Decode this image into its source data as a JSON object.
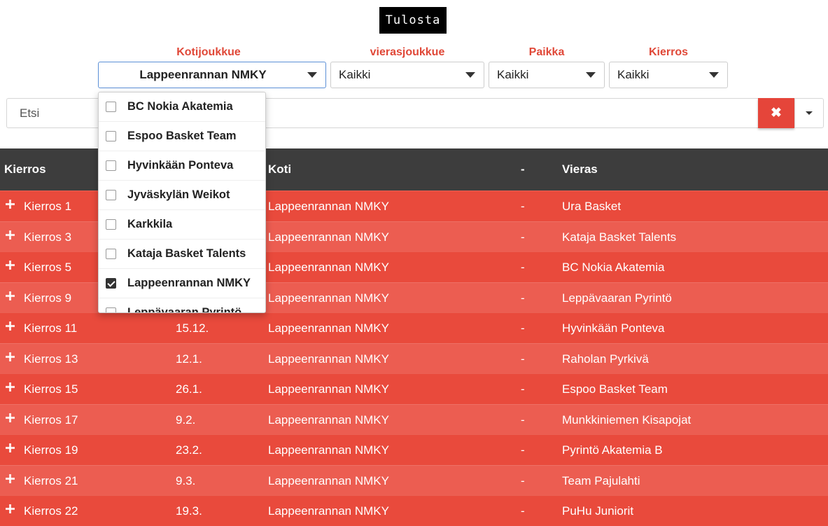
{
  "print_button": "Tulosta",
  "filters": {
    "home": {
      "label": "Kotijoukkue",
      "value": "Lappeenrannan NMKY"
    },
    "away": {
      "label": "vierasjoukkue",
      "value": "Kaikki"
    },
    "place": {
      "label": "Paikka",
      "value": "Kaikki"
    },
    "round": {
      "label": "Kierros",
      "value": "Kaikki"
    }
  },
  "search": {
    "placeholder": "Etsi",
    "clear_icon": "close-icon",
    "more_icon": "caret-down-icon"
  },
  "dropdown_options": [
    {
      "label": "BC Nokia Akatemia",
      "checked": false
    },
    {
      "label": "Espoo Basket Team",
      "checked": false
    },
    {
      "label": "Hyvinkään Ponteva",
      "checked": false
    },
    {
      "label": "Jyväskylän Weikot",
      "checked": false
    },
    {
      "label": "Karkkila",
      "checked": false
    },
    {
      "label": "Kataja Basket Talents",
      "checked": false
    },
    {
      "label": "Lappeenrannan NMKY",
      "checked": true
    },
    {
      "label": "Leppävaaran Pyrintö",
      "checked": false
    }
  ],
  "table": {
    "headers": {
      "round": "Kierros",
      "home": "Koti",
      "dash": "-",
      "away": "Vieras"
    },
    "rows": [
      {
        "round": "Kierros 1",
        "date": "",
        "home": "Lappeenrannan NMKY",
        "dash": "-",
        "away": "Ura Basket"
      },
      {
        "round": "Kierros 3",
        "date": "",
        "home": "Lappeenrannan NMKY",
        "dash": "-",
        "away": "Kataja Basket Talents"
      },
      {
        "round": "Kierros 5",
        "date": "",
        "home": "Lappeenrannan NMKY",
        "dash": "-",
        "away": "BC Nokia Akatemia"
      },
      {
        "round": "Kierros 9",
        "date": "",
        "home": "Lappeenrannan NMKY",
        "dash": "-",
        "away": "Leppävaaran Pyrintö"
      },
      {
        "round": "Kierros 11",
        "date": "15.12.",
        "home": "Lappeenrannan NMKY",
        "dash": "-",
        "away": "Hyvinkään Ponteva"
      },
      {
        "round": "Kierros 13",
        "date": "12.1.",
        "home": "Lappeenrannan NMKY",
        "dash": "-",
        "away": "Raholan Pyrkivä"
      },
      {
        "round": "Kierros 15",
        "date": "26.1.",
        "home": "Lappeenrannan NMKY",
        "dash": "-",
        "away": "Espoo Basket Team"
      },
      {
        "round": "Kierros 17",
        "date": "9.2.",
        "home": "Lappeenrannan NMKY",
        "dash": "-",
        "away": "Munkkiniemen Kisapojat"
      },
      {
        "round": "Kierros 19",
        "date": "23.2.",
        "home": "Lappeenrannan NMKY",
        "dash": "-",
        "away": "Pyrintö Akatemia B"
      },
      {
        "round": "Kierros 21",
        "date": "9.3.",
        "home": "Lappeenrannan NMKY",
        "dash": "-",
        "away": "Team Pajulahti"
      },
      {
        "round": "Kierros 22",
        "date": "19.3.",
        "home": "Lappeenrannan NMKY",
        "dash": "-",
        "away": "PuHu Juniorit"
      }
    ]
  }
}
